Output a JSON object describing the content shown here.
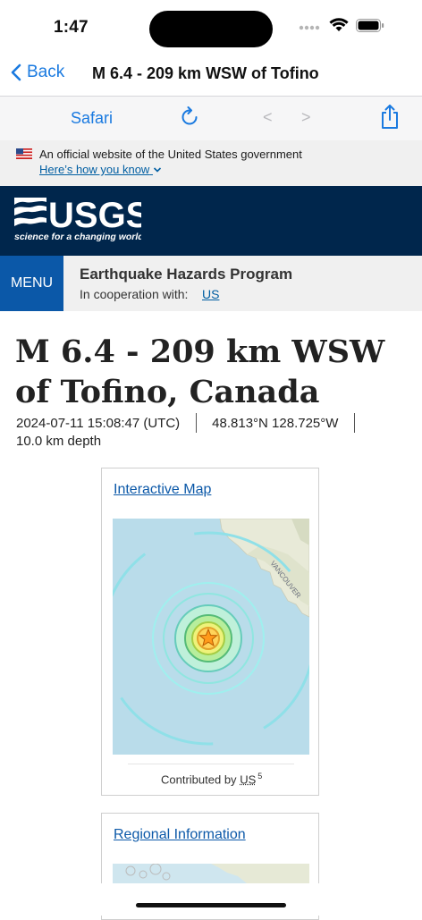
{
  "status_bar": {
    "time": "1:47"
  },
  "nav": {
    "back_label": "Back",
    "title": "M 6.4 - 209 km WSW of Tofino"
  },
  "safari_toolbar": {
    "label": "Safari",
    "prev": "<",
    "next": ">"
  },
  "gov_banner": {
    "text": "An official website of the United States government",
    "link": "Here’s how you know"
  },
  "usgs": {
    "logo_word": "USGS",
    "tagline": "science for a changing world"
  },
  "menu": {
    "button": "MENU",
    "program": "Earthquake Hazards Program",
    "coop_label": "In cooperation with:",
    "coop_link": "US"
  },
  "event": {
    "title": "M 6.4 - 209 km WSW of Tofino, Canada",
    "time": "2024-07-11 15:08:47 (UTC)",
    "location": "48.813°N 128.725°W",
    "depth": "10.0 km depth"
  },
  "interactive_map": {
    "link": "Interactive Map",
    "contributed_label": "Contributed by",
    "contributor": "US",
    "contributor_count": "5",
    "map_label": "VANCOUVER"
  },
  "regional": {
    "link": "Regional Information"
  },
  "colors": {
    "ios_blue": "#1a7ae0",
    "usgs_navy": "#00264c",
    "menu_blue": "#0b58a8",
    "link_blue": "#005ea2"
  }
}
